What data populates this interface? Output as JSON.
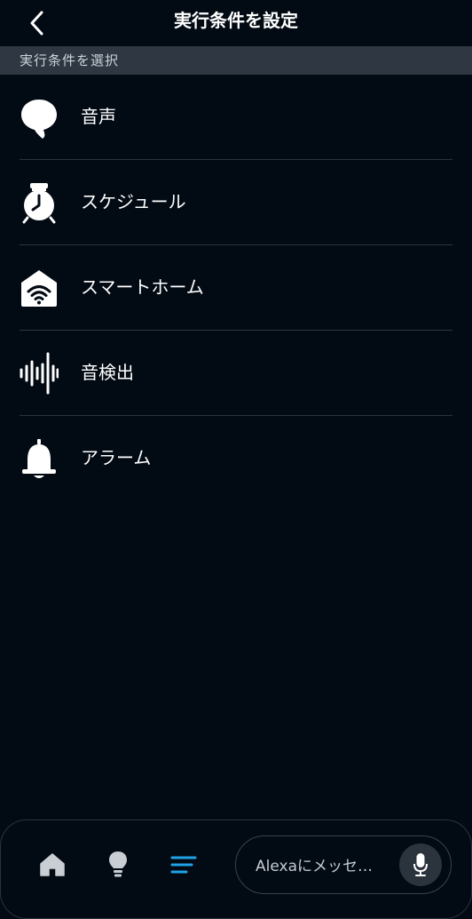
{
  "header": {
    "title": "実行条件を設定",
    "back_icon": "chevron-left-icon"
  },
  "section": {
    "title": "実行条件を選択"
  },
  "triggers": [
    {
      "label": "音声",
      "icon": "speech-bubble-icon"
    },
    {
      "label": "スケジュール",
      "icon": "alarm-clock-icon"
    },
    {
      "label": "スマートホーム",
      "icon": "smart-home-icon"
    },
    {
      "label": "音検出",
      "icon": "sound-wave-icon"
    },
    {
      "label": "アラーム",
      "icon": "bell-icon"
    }
  ],
  "bottom_nav": {
    "home_icon": "home-icon",
    "devices_icon": "lightbulb-icon",
    "more_icon": "menu-lines-icon",
    "message_placeholder": "Alexaにメッセ…",
    "mic_icon": "microphone-icon",
    "active_color": "#1fa3e6"
  },
  "colors": {
    "background": "#020a13",
    "section_bar": "#2e3742",
    "divider": "#2c343d"
  }
}
